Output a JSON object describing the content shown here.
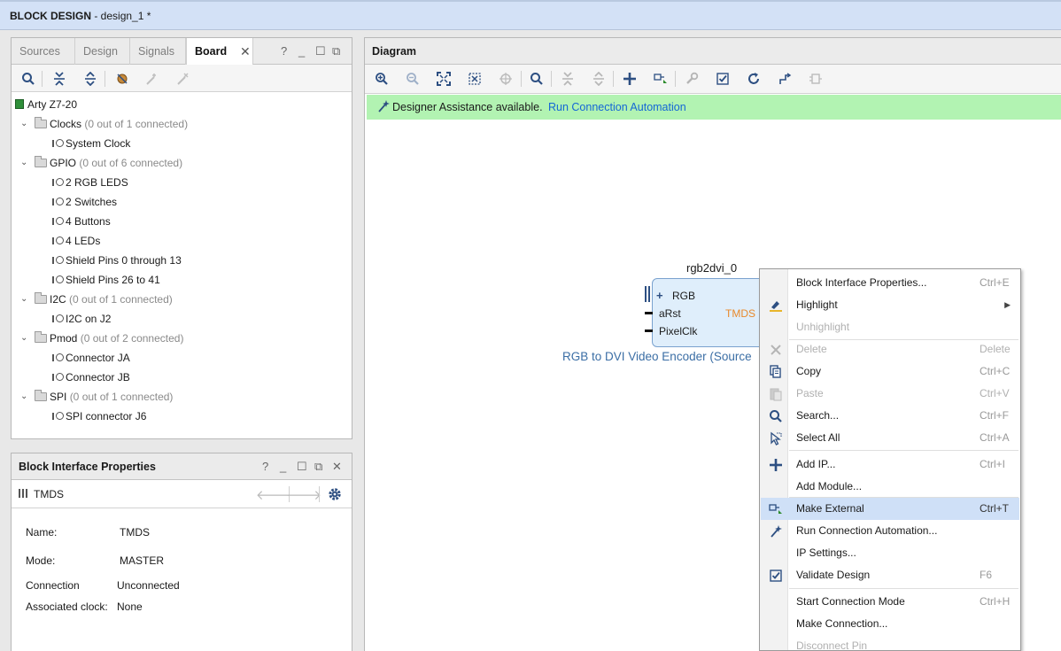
{
  "window": {
    "title_bold": "BLOCK DESIGN",
    "title_rest": " - design_1 *"
  },
  "left_panel": {
    "tabs": [
      {
        "label": "Sources",
        "active": false
      },
      {
        "label": "Design",
        "active": false
      },
      {
        "label": "Signals",
        "active": false
      },
      {
        "label": "Board",
        "active": true
      }
    ],
    "window_controls": {
      "help": "?",
      "minimize": "_",
      "maximize": "☐",
      "float": "⧉"
    },
    "tree": {
      "root": "Arty Z7-20",
      "groups": [
        {
          "label": "Clocks",
          "status": "(0 out of 1 connected)",
          "items": [
            "System Clock"
          ]
        },
        {
          "label": "GPIO",
          "status": "(0 out of 6 connected)",
          "items": [
            "2 RGB LEDS",
            "2 Switches",
            "4 Buttons",
            "4 LEDs",
            "Shield Pins 0 through 13",
            "Shield Pins 26 to 41"
          ]
        },
        {
          "label": "I2C",
          "status": "(0 out of 1 connected)",
          "items": [
            "I2C on J2"
          ]
        },
        {
          "label": "Pmod",
          "status": "(0 out of 2 connected)",
          "items": [
            "Connector JA",
            "Connector JB"
          ]
        },
        {
          "label": "SPI",
          "status": "(0 out of 1 connected)",
          "items": [
            "SPI connector J6"
          ]
        }
      ]
    }
  },
  "properties_panel": {
    "title": "Block Interface Properties",
    "object_name": "TMDS",
    "props": [
      {
        "label": "Name:",
        "value": "TMDS"
      },
      {
        "label": "Mode:",
        "value": "MASTER"
      },
      {
        "label": "Connection",
        "value": "Unconnected"
      },
      {
        "label": "Associated clock:",
        "value": "None"
      }
    ]
  },
  "diagram": {
    "title": "Diagram",
    "assist_text": "Designer Assistance available.",
    "assist_link": "Run Connection Automation",
    "block": {
      "instance": "rgb2dvi_0",
      "pins_in": [
        "RGB",
        "aRst",
        "PixelClk"
      ],
      "pin_out": "TMDS",
      "description": "RGB to DVI Video Encoder (Source"
    }
  },
  "context_menu": {
    "items": [
      {
        "label": "Block Interface Properties...",
        "shortcut": "Ctrl+E",
        "icon": "",
        "disabled": false
      },
      {
        "label": "Highlight",
        "shortcut": "",
        "icon": "highlight-icon",
        "disabled": false,
        "submenu": true
      },
      {
        "label": "Unhighlight",
        "shortcut": "",
        "icon": "",
        "disabled": true
      },
      {
        "label": "Delete",
        "shortcut": "Delete",
        "icon": "delete-icon",
        "disabled": true
      },
      {
        "label": "Copy",
        "shortcut": "Ctrl+C",
        "icon": "copy-icon",
        "disabled": false
      },
      {
        "label": "Paste",
        "shortcut": "Ctrl+V",
        "icon": "paste-icon",
        "disabled": true
      },
      {
        "label": "Search...",
        "shortcut": "Ctrl+F",
        "icon": "search-icon",
        "disabled": false
      },
      {
        "label": "Select All",
        "shortcut": "Ctrl+A",
        "icon": "select-all-icon",
        "disabled": false
      },
      {
        "label": "Add IP...",
        "shortcut": "Ctrl+I",
        "icon": "add-icon",
        "disabled": false
      },
      {
        "label": "Add Module...",
        "shortcut": "",
        "icon": "",
        "disabled": false
      },
      {
        "label": "Make External",
        "shortcut": "Ctrl+T",
        "icon": "make-external-icon",
        "disabled": false,
        "highlighted": true
      },
      {
        "label": "Run Connection Automation...",
        "shortcut": "",
        "icon": "wand-icon",
        "disabled": false
      },
      {
        "label": "IP Settings...",
        "shortcut": "",
        "icon": "",
        "disabled": false
      },
      {
        "label": "Validate Design",
        "shortcut": "F6",
        "icon": "validate-icon",
        "disabled": false
      },
      {
        "label": "Start Connection Mode",
        "shortcut": "Ctrl+H",
        "icon": "",
        "disabled": false
      },
      {
        "label": "Make Connection...",
        "shortcut": "",
        "icon": "",
        "disabled": false
      },
      {
        "label": "Disconnect Pin",
        "shortcut": "",
        "icon": "",
        "disabled": true
      }
    ]
  },
  "colors": {
    "accent": "#1466d6",
    "assist_bg": "#b2f3b2",
    "title_bg": "#d3e1f6",
    "menu_highlight": "#cfe0f7",
    "port_label": "#e8892b",
    "block_desc": "#3b6ea5"
  }
}
